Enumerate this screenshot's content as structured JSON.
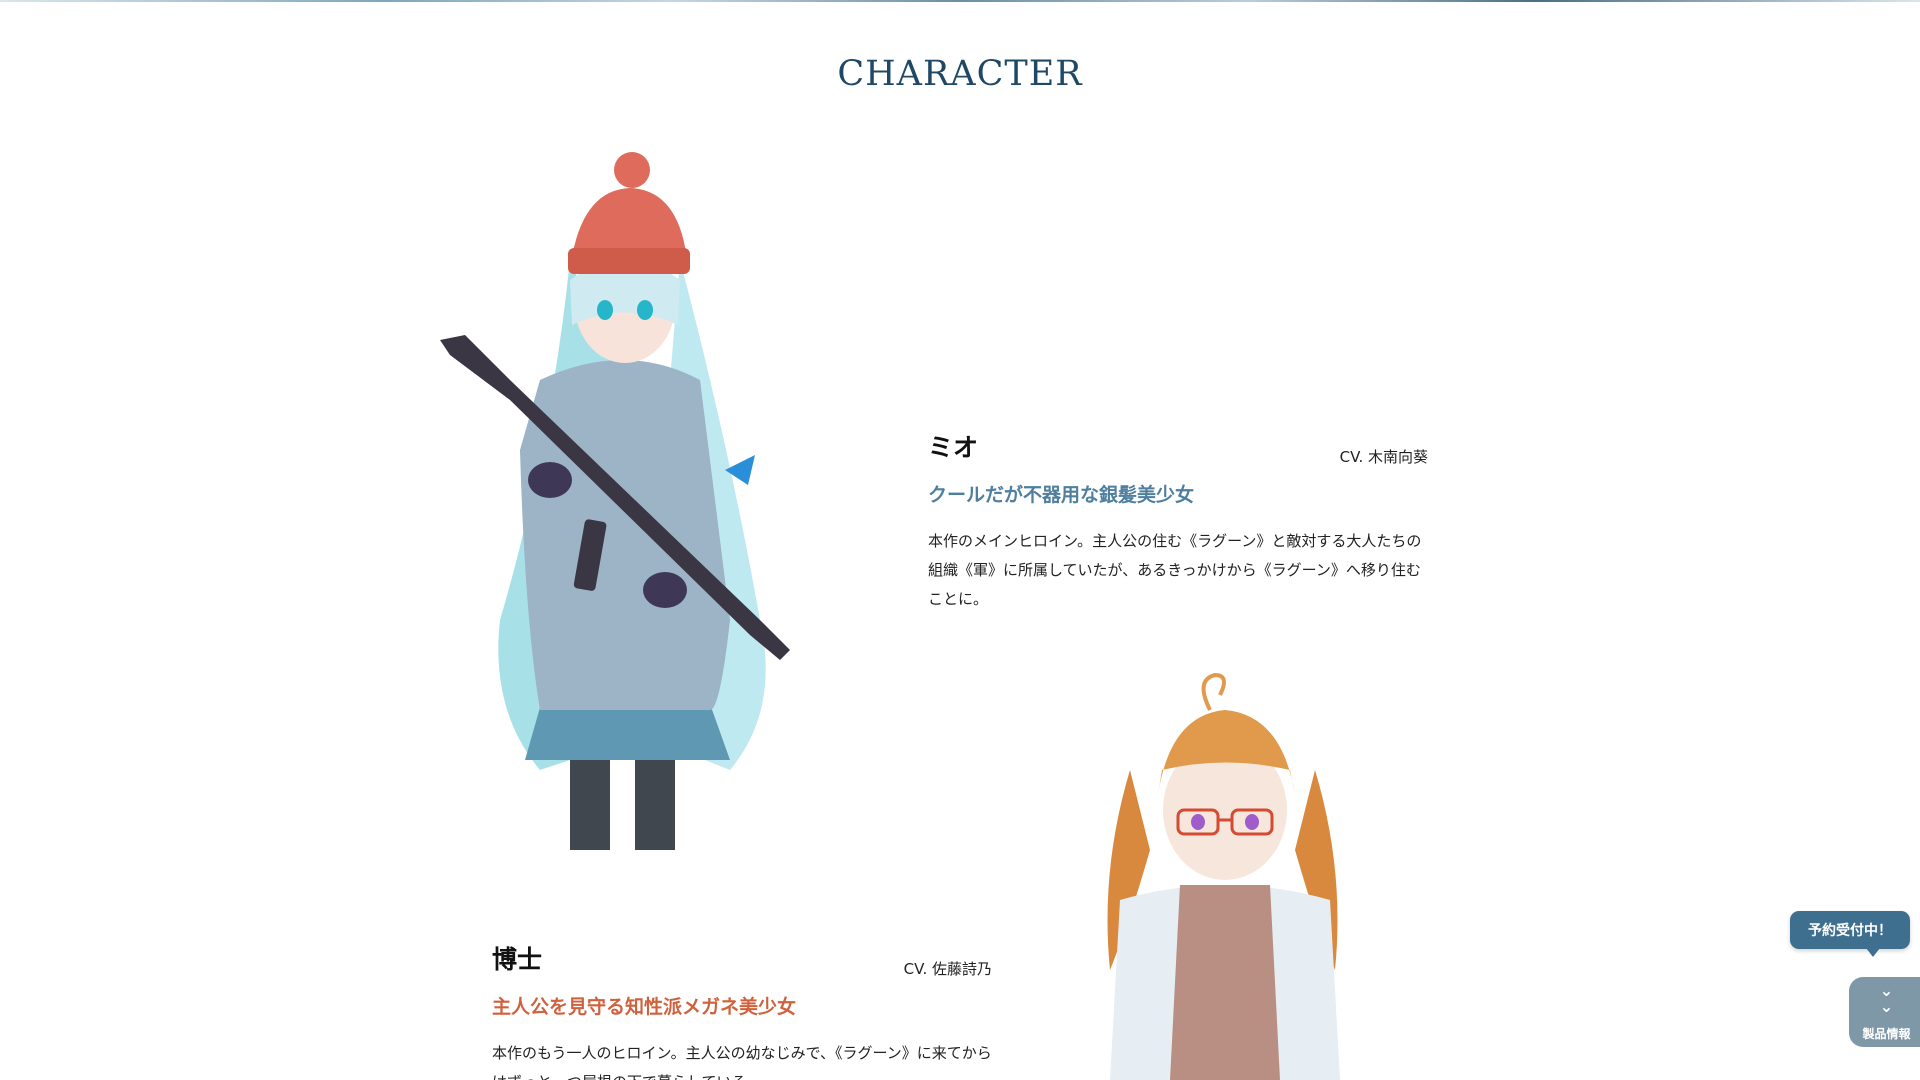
{
  "section": {
    "title": "CHARACTER"
  },
  "characters": [
    {
      "name": "ミオ",
      "cv": "CV. 木南向葵",
      "catch": "クールだが不器用な銀髪美少女",
      "desc": "本作のメインヒロイン。主人公の住む《ラグーン》と敵対する大人たちの組織《軍》に所属していたが、あるきっかけから《ラグーン》へ移り住むことに。",
      "accent": "#4e7f9f"
    },
    {
      "name": "博士",
      "cv": "CV. 佐藤詩乃",
      "catch": "主人公を見守る知性派メガネ美少女",
      "desc": "本作のもう一人のヒロイン。主人公の幼なじみで、《ラグーン》に来てからはずっと一つ屋根の下で暮らしている。",
      "accent": "#d0613d"
    }
  ],
  "widgets": {
    "reserve": "予約受付中！",
    "product": "製品情報",
    "product_icon": "double-chevron-down-icon"
  },
  "colors": {
    "title": "#1e4866",
    "widget_bubble": "#3f6f8f",
    "widget_button": "#7f98a8"
  }
}
